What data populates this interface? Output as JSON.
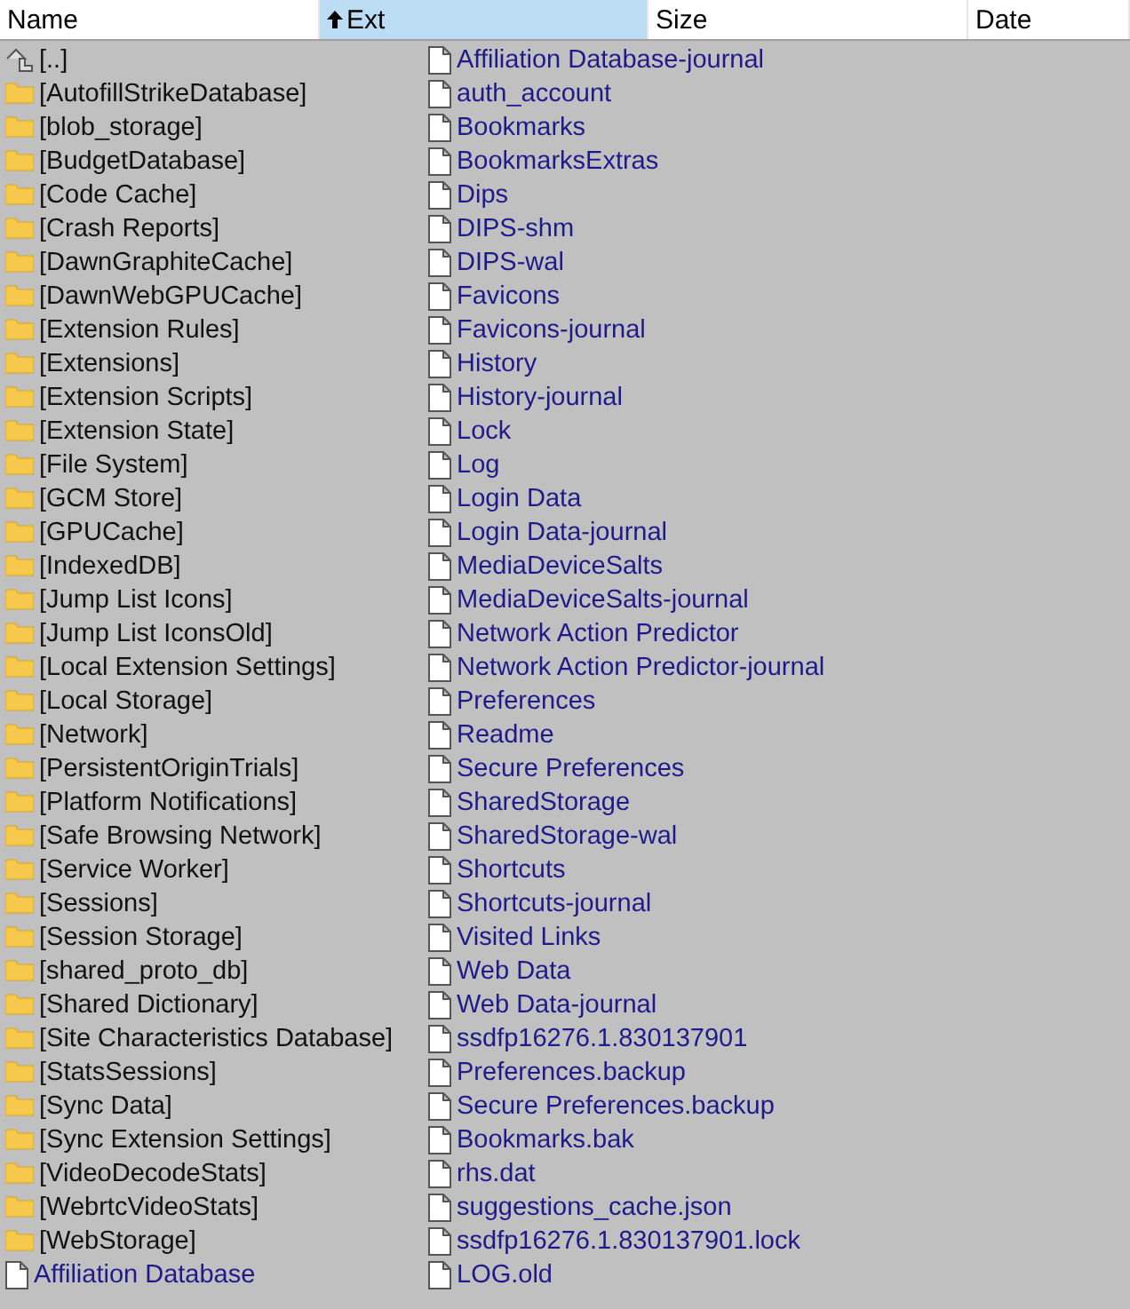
{
  "columns": [
    {
      "label": "Name",
      "selected": false
    },
    {
      "label": "Ext",
      "selected": true
    },
    {
      "label": "Size",
      "selected": false
    },
    {
      "label": "Date",
      "selected": false
    }
  ],
  "entries": [
    {
      "kind": "up",
      "name": "[..]"
    },
    {
      "kind": "folder",
      "name": "[AutofillStrikeDatabase]"
    },
    {
      "kind": "folder",
      "name": "[blob_storage]"
    },
    {
      "kind": "folder",
      "name": "[BudgetDatabase]"
    },
    {
      "kind": "folder",
      "name": "[Code Cache]"
    },
    {
      "kind": "folder",
      "name": "[Crash Reports]"
    },
    {
      "kind": "folder",
      "name": "[DawnGraphiteCache]"
    },
    {
      "kind": "folder",
      "name": "[DawnWebGPUCache]"
    },
    {
      "kind": "folder",
      "name": "[Extension Rules]"
    },
    {
      "kind": "folder",
      "name": "[Extensions]"
    },
    {
      "kind": "folder",
      "name": "[Extension Scripts]"
    },
    {
      "kind": "folder",
      "name": "[Extension State]"
    },
    {
      "kind": "folder",
      "name": "[File System]"
    },
    {
      "kind": "folder",
      "name": "[GCM Store]"
    },
    {
      "kind": "folder",
      "name": "[GPUCache]"
    },
    {
      "kind": "folder",
      "name": "[IndexedDB]"
    },
    {
      "kind": "folder",
      "name": "[Jump List Icons]"
    },
    {
      "kind": "folder",
      "name": "[Jump List IconsOld]"
    },
    {
      "kind": "folder",
      "name": "[Local Extension Settings]"
    },
    {
      "kind": "folder",
      "name": "[Local Storage]"
    },
    {
      "kind": "folder",
      "name": "[Network]"
    },
    {
      "kind": "folder",
      "name": "[PersistentOriginTrials]"
    },
    {
      "kind": "folder",
      "name": "[Platform Notifications]"
    },
    {
      "kind": "folder",
      "name": "[Safe Browsing Network]"
    },
    {
      "kind": "folder",
      "name": "[Service Worker]"
    },
    {
      "kind": "folder",
      "name": "[Sessions]"
    },
    {
      "kind": "folder",
      "name": "[Session Storage]"
    },
    {
      "kind": "folder",
      "name": "[shared_proto_db]"
    },
    {
      "kind": "folder",
      "name": "[Shared Dictionary]"
    },
    {
      "kind": "folder",
      "name": "[Site Characteristics Database]"
    },
    {
      "kind": "folder",
      "name": "[StatsSessions]"
    },
    {
      "kind": "folder",
      "name": "[Sync Data]"
    },
    {
      "kind": "folder",
      "name": "[Sync Extension Settings]"
    },
    {
      "kind": "folder",
      "name": "[VideoDecodeStats]"
    },
    {
      "kind": "folder",
      "name": "[WebrtcVideoStats]"
    },
    {
      "kind": "folder",
      "name": "[WebStorage]"
    },
    {
      "kind": "file",
      "name": "Affiliation Database"
    },
    {
      "kind": "file",
      "name": "Affiliation Database-journal"
    },
    {
      "kind": "file",
      "name": "auth_account"
    },
    {
      "kind": "file",
      "name": "Bookmarks"
    },
    {
      "kind": "file",
      "name": "BookmarksExtras"
    },
    {
      "kind": "file",
      "name": "Dips"
    },
    {
      "kind": "file",
      "name": "DIPS-shm"
    },
    {
      "kind": "file",
      "name": "DIPS-wal"
    },
    {
      "kind": "file",
      "name": "Favicons"
    },
    {
      "kind": "file",
      "name": "Favicons-journal"
    },
    {
      "kind": "file",
      "name": "History"
    },
    {
      "kind": "file",
      "name": "History-journal"
    },
    {
      "kind": "file",
      "name": "Lock"
    },
    {
      "kind": "file",
      "name": "Log"
    },
    {
      "kind": "file",
      "name": "Login Data"
    },
    {
      "kind": "file",
      "name": "Login Data-journal"
    },
    {
      "kind": "file",
      "name": "MediaDeviceSalts"
    },
    {
      "kind": "file",
      "name": "MediaDeviceSalts-journal"
    },
    {
      "kind": "file",
      "name": "Network Action Predictor"
    },
    {
      "kind": "file",
      "name": "Network Action Predictor-journal"
    },
    {
      "kind": "file",
      "name": "Preferences"
    },
    {
      "kind": "file",
      "name": "Readme"
    },
    {
      "kind": "file",
      "name": "Secure Preferences"
    },
    {
      "kind": "file",
      "name": "SharedStorage"
    },
    {
      "kind": "file",
      "name": "SharedStorage-wal"
    },
    {
      "kind": "file",
      "name": "Shortcuts"
    },
    {
      "kind": "file",
      "name": "Shortcuts-journal"
    },
    {
      "kind": "file",
      "name": "Visited Links"
    },
    {
      "kind": "file",
      "name": "Web Data"
    },
    {
      "kind": "file",
      "name": "Web Data-journal"
    },
    {
      "kind": "file",
      "name": "ssdfp16276.1.830137901"
    },
    {
      "kind": "file",
      "name": "Preferences.backup"
    },
    {
      "kind": "file",
      "name": "Secure Preferences.backup"
    },
    {
      "kind": "file",
      "name": "Bookmarks.bak"
    },
    {
      "kind": "file",
      "name": "rhs.dat"
    },
    {
      "kind": "file",
      "name": "suggestions_cache.json"
    },
    {
      "kind": "file",
      "name": "ssdfp16276.1.830137901.lock"
    },
    {
      "kind": "file",
      "name": "LOG.old"
    }
  ]
}
